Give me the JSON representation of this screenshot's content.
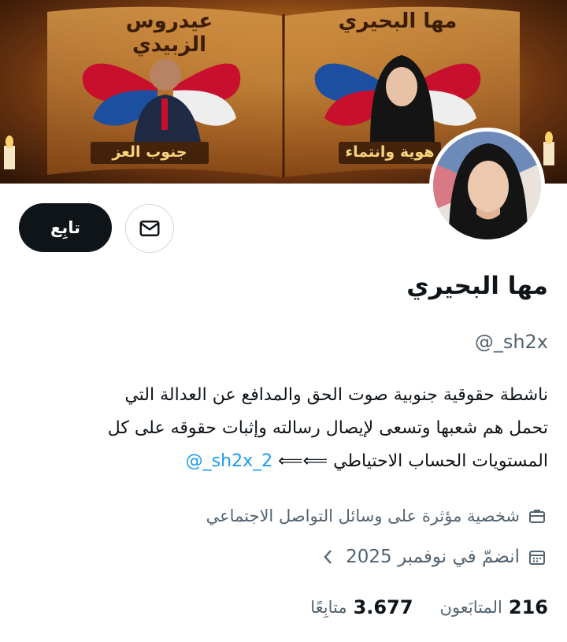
{
  "banner": {
    "left_title": "عيدروس الزبيدي",
    "left_caption": "جنوب العز",
    "right_title": "مها البحيري",
    "right_caption": "هوية وانتماء"
  },
  "profile": {
    "name": "مها البحيري",
    "handle": "@_sh2x",
    "follow_label": "تابِع",
    "bio_line1": "ناشطة حقوقية جنوبية صوت الحق والمدافع عن العدالة التي",
    "bio_line2": "تحمل هم شعبها وتسعى لإيصال رسالته وإثبات حقوقه على كل",
    "bio_line3_text": "المستويات  الحساب الاحتياطي ⟸⟸",
    "bio_link": "@_sh2x_2",
    "category": "شخصية مؤثرة على وسائل التواصل الاجتماعي",
    "joined": "انضمّ في نوفمبر 2025"
  },
  "stats": {
    "followers_count": "216",
    "followers_label": "المتابَعون",
    "following_count": "3.677",
    "following_label": "متابِعًا"
  },
  "colors": {
    "text": "#0f1419",
    "secondary": "#536471",
    "link": "#1d9bf0",
    "button_dark": "#0f1419",
    "border": "#cfd9de"
  },
  "icons": [
    "mail-icon",
    "briefcase-icon",
    "calendar-icon",
    "chevron-left-icon"
  ]
}
